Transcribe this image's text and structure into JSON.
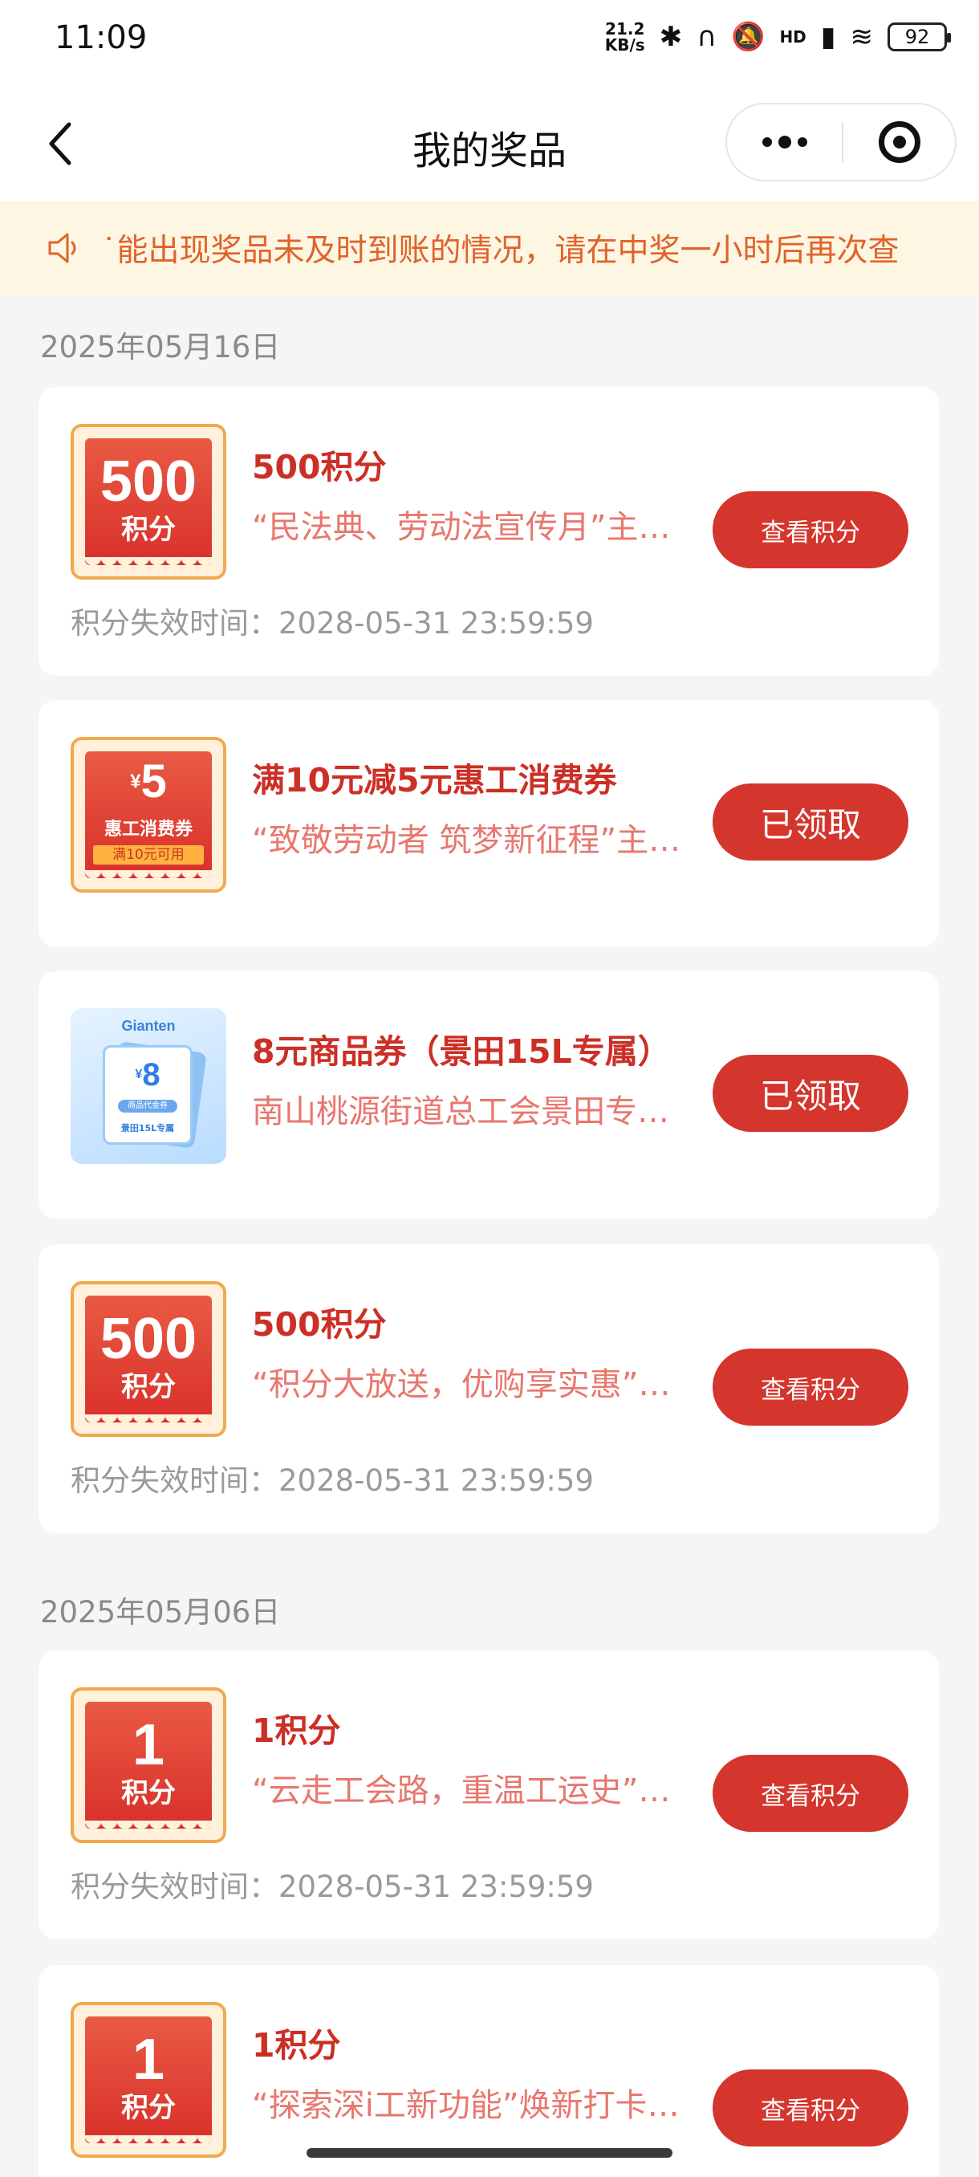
{
  "status_bar": {
    "time": "11:09",
    "speed_value": "21.2",
    "speed_unit": "KB/s",
    "hd_label": "HD",
    "battery": "92"
  },
  "nav": {
    "title": "我的奖品"
  },
  "notice": {
    "text": "˙能出现奖品未及时到账的情况，请在中奖一小时后再次查"
  },
  "groups": [
    {
      "date": "2025年05月16日"
    },
    {
      "date": "2025年05月06日"
    }
  ],
  "prizes": [
    {
      "thumb": {
        "num": "500",
        "unit": "积分"
      },
      "title": "500积分",
      "desc": "“民法典、劳动法宣传月”主题活动",
      "button": "查看积分",
      "expire": "积分失效时间：2028-05-31 23:59:59"
    },
    {
      "thumb": {
        "yen": "¥",
        "num": "5",
        "name": "惠工消费券",
        "cond": "满10元可用"
      },
      "title": "满10元减5元惠工消费券",
      "desc": "“致敬劳动者 筑梦新征程”主题活动",
      "button": "已领取"
    },
    {
      "thumb": {
        "brand": "Gianten",
        "yen": "¥",
        "num": "8",
        "sub": "商品代金券",
        "foot": "景田15L专属"
      },
      "title": "8元商品券（景田15L专属）",
      "desc": "南山桃源街道总工会景田专属活动",
      "button": "已领取"
    },
    {
      "thumb": {
        "num": "500",
        "unit": "积分"
      },
      "title": "500积分",
      "desc": "“积分大放送，优购享实惠”活动",
      "button": "查看积分",
      "expire": "积分失效时间：2028-05-31 23:59:59"
    },
    {
      "thumb": {
        "num": "1",
        "unit": "积分"
      },
      "title": "1积分",
      "desc": "“云走工会路，重温工运史”活动",
      "button": "查看积分",
      "expire": "积分失效时间：2028-05-31 23:59:59"
    },
    {
      "thumb": {
        "num": "1",
        "unit": "积分"
      },
      "title": "1积分",
      "desc": "“探索深i工新功能”焕新打卡活动",
      "button": "查看积分"
    }
  ]
}
